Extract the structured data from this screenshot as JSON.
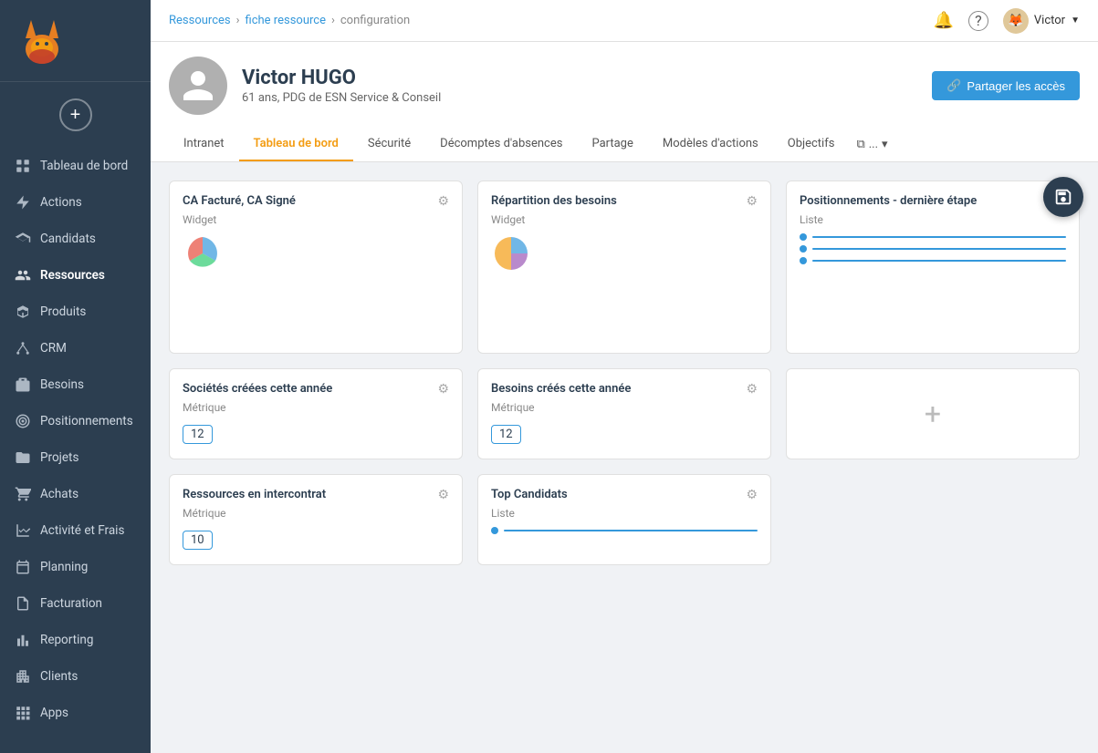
{
  "topbar": {
    "breadcrumb": [
      "Ressources",
      "fiche ressource",
      "configuration"
    ],
    "user_name": "Victor",
    "notification_icon": "🔔",
    "help_icon": "?"
  },
  "profile": {
    "name": "Victor HUGO",
    "subtitle": "61 ans, PDG de ESN Service & Conseil",
    "share_button": "Partager les accès"
  },
  "tabs": [
    {
      "label": "Intranet",
      "active": false
    },
    {
      "label": "Tableau de bord",
      "active": true
    },
    {
      "label": "Sécurité",
      "active": false
    },
    {
      "label": "Décomptes d'absences",
      "active": false
    },
    {
      "label": "Partage",
      "active": false
    },
    {
      "label": "Modèles d'actions",
      "active": false
    },
    {
      "label": "Objectifs",
      "active": false
    },
    {
      "label": "...",
      "active": false
    }
  ],
  "sidebar": {
    "items": [
      {
        "label": "Tableau de bord",
        "icon": "grid",
        "active": false
      },
      {
        "label": "Actions",
        "icon": "lightning",
        "active": false
      },
      {
        "label": "Candidats",
        "icon": "graduation",
        "active": false
      },
      {
        "label": "Ressources",
        "icon": "people",
        "active": true
      },
      {
        "label": "Produits",
        "icon": "box",
        "active": false
      },
      {
        "label": "CRM",
        "icon": "network",
        "active": false
      },
      {
        "label": "Besoins",
        "icon": "briefcase",
        "active": false
      },
      {
        "label": "Positionnements",
        "icon": "target",
        "active": false
      },
      {
        "label": "Projets",
        "icon": "folder",
        "active": false
      },
      {
        "label": "Achats",
        "icon": "cart",
        "active": false
      },
      {
        "label": "Activité et Frais",
        "icon": "chart",
        "active": false
      },
      {
        "label": "Planning",
        "icon": "calendar",
        "active": false
      },
      {
        "label": "Facturation",
        "icon": "invoice",
        "active": false
      },
      {
        "label": "Reporting",
        "icon": "bar-chart",
        "active": false
      },
      {
        "label": "Clients",
        "icon": "building",
        "active": false
      },
      {
        "label": "Apps",
        "icon": "apps",
        "active": false
      }
    ]
  },
  "widgets": {
    "row1": [
      {
        "title": "CA Facturé, CA Signé",
        "type": "Widget",
        "icon": "pie",
        "id": "ca-facture"
      },
      {
        "title": "Répartition des besoins",
        "type": "Widget",
        "icon": "pie",
        "id": "repartition-besoins"
      },
      {
        "title": "Positionnements - dernière étape",
        "type": "Liste",
        "icon": "list",
        "id": "positionnements"
      }
    ],
    "row2": [
      {
        "title": "Sociétés créées cette année",
        "type": "Métrique",
        "icon": "metric",
        "value": "12",
        "id": "societes"
      },
      {
        "title": "Besoins créés cette année",
        "type": "Métrique",
        "icon": "metric",
        "value": "12",
        "id": "besoins"
      },
      {
        "title": "",
        "type": "add",
        "id": "add-widget-2"
      }
    ],
    "row3": [
      {
        "title": "Ressources en intercontrat",
        "type": "Métrique",
        "icon": "metric",
        "value": "10",
        "id": "ressources-intercontrat"
      },
      {
        "title": "Top Candidats",
        "type": "Liste",
        "icon": "list",
        "id": "top-candidats"
      }
    ]
  }
}
